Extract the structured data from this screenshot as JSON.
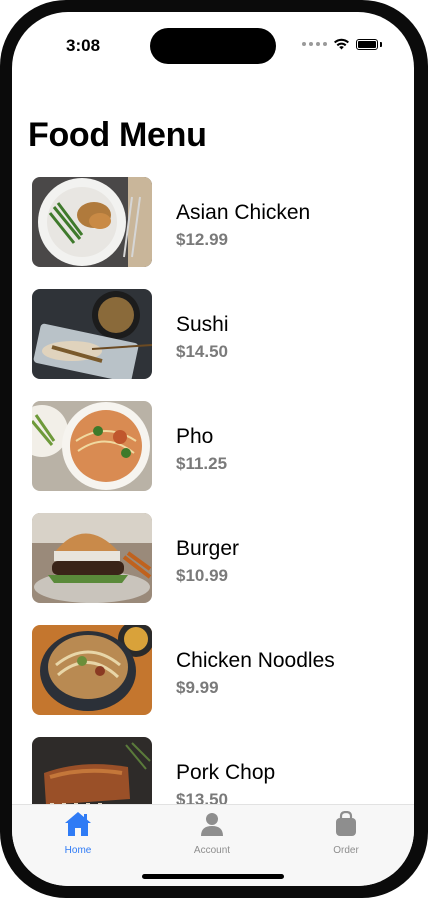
{
  "status": {
    "time": "3:08"
  },
  "page": {
    "title": "Food Menu"
  },
  "menu": [
    {
      "name": "Asian Chicken",
      "price": "$12.99"
    },
    {
      "name": "Sushi",
      "price": "$14.50"
    },
    {
      "name": "Pho",
      "price": "$11.25"
    },
    {
      "name": "Burger",
      "price": "$10.99"
    },
    {
      "name": "Chicken Noodles",
      "price": "$9.99"
    },
    {
      "name": "Pork Chop",
      "price": "$13.50"
    }
  ],
  "tabs": [
    {
      "label": "Home",
      "icon": "house-icon",
      "active": true
    },
    {
      "label": "Account",
      "icon": "person-icon",
      "active": false
    },
    {
      "label": "Order",
      "icon": "bag-icon",
      "active": false
    }
  ],
  "colors": {
    "accent": "#2f7bf5",
    "inactive_tab": "#8e8e8e",
    "price": "#7a7a7a"
  }
}
